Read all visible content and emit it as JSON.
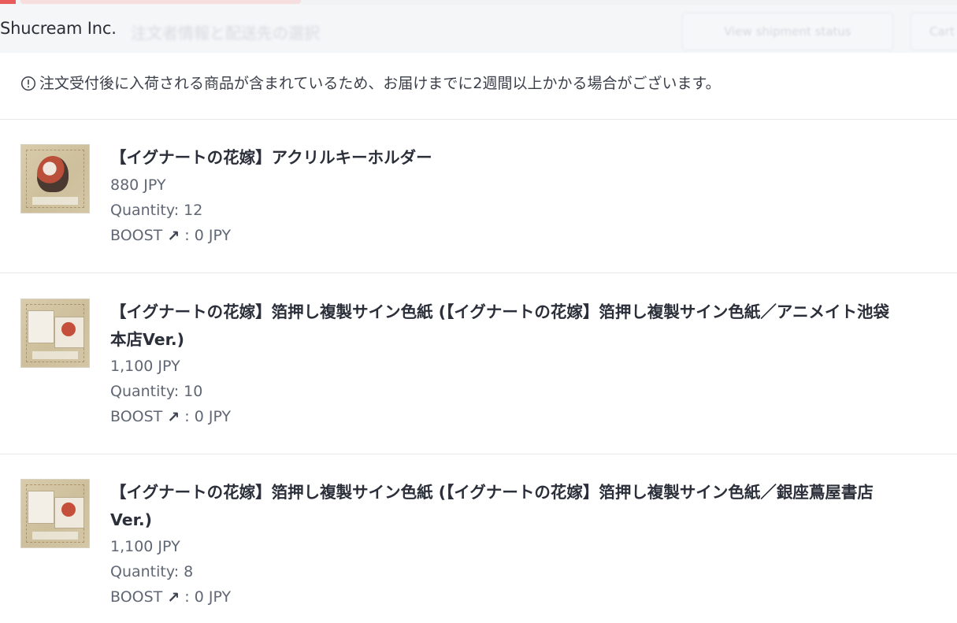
{
  "header": {
    "shop_name": "Shucream Inc.",
    "ghost_title": "注文者情報と配送先の選択",
    "ghost_button_1": "View shipment status",
    "ghost_button_2": "Cart"
  },
  "notice": {
    "text": "注文受付後に入荷される商品が含まれているため、お届けまでに2週間以上かかる場合がございます。"
  },
  "items": [
    {
      "title": "【イグナートの花嫁】アクリルキーホルダー",
      "price": "880 JPY",
      "quantity": "Quantity: 12",
      "boost_prefix": "BOOST",
      "boost_suffix": ": 0 JPY"
    },
    {
      "title_line1": "【イグナートの花嫁】箔押し複製サイン色紙 (【イグナートの花嫁】箔押し複製サイン色紙／アニメイト池袋",
      "title_line2": "本店Ver.)",
      "price": "1,100 JPY",
      "quantity": "Quantity: 10",
      "boost_prefix": "BOOST",
      "boost_suffix": ": 0 JPY"
    },
    {
      "title_line1": "【イグナートの花嫁】箔押し複製サイン色紙 (【イグナートの花嫁】箔押し複製サイン色紙／銀座蔦屋書店",
      "title_line2": "Ver.)",
      "price": "1,100 JPY",
      "quantity": "Quantity: 8",
      "boost_prefix": "BOOST",
      "boost_suffix": ": 0 JPY"
    }
  ],
  "icons": {
    "notice": "info-circle-icon",
    "boost": "arrow-up-right-icon"
  },
  "colors": {
    "accent_red": "#e95a5a",
    "header_bg": "#f4f6f8",
    "text_dark": "#2b2f3a",
    "text_muted": "#606774"
  }
}
